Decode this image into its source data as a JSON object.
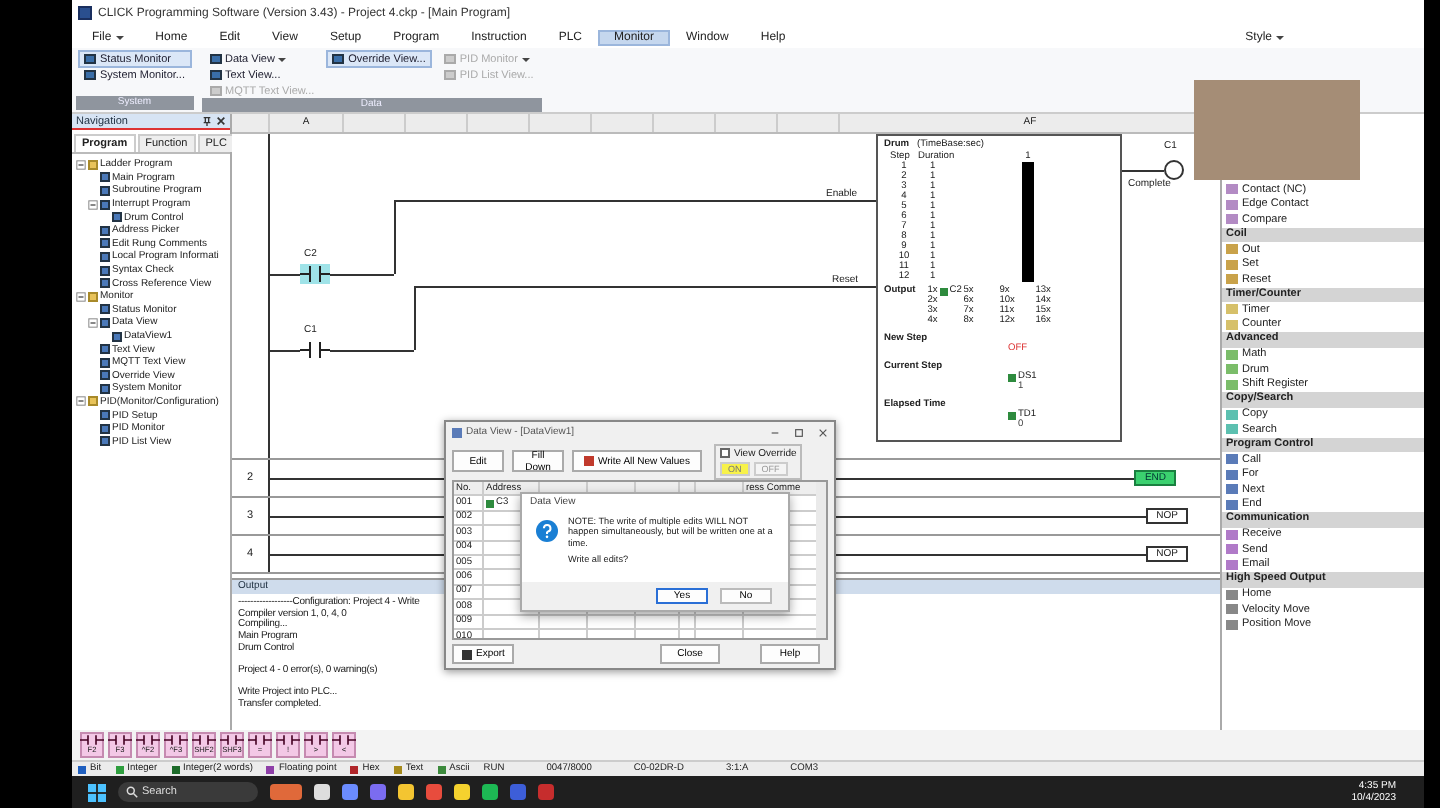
{
  "window": {
    "title": "CLICK Programming Software (Version 3.43) - Project 4.ckp - [Main Program]",
    "style_menu": "Style"
  },
  "menu": [
    {
      "label": "File",
      "selected": false,
      "dropdown": true
    },
    {
      "label": "Home",
      "selected": false,
      "dropdown": false
    },
    {
      "label": "Edit",
      "selected": false,
      "dropdown": false
    },
    {
      "label": "View",
      "selected": false,
      "dropdown": false
    },
    {
      "label": "Setup",
      "selected": false,
      "dropdown": false
    },
    {
      "label": "Program",
      "selected": false,
      "dropdown": false
    },
    {
      "label": "Instruction",
      "selected": false,
      "dropdown": false
    },
    {
      "label": "PLC",
      "selected": false,
      "dropdown": false
    },
    {
      "label": "Monitor",
      "selected": true,
      "dropdown": false
    },
    {
      "label": "Window",
      "selected": false,
      "dropdown": false
    },
    {
      "label": "Help",
      "selected": false,
      "dropdown": false
    }
  ],
  "ribbon": {
    "groups": [
      {
        "label": "System",
        "columns": [
          [
            {
              "label": "Status Monitor",
              "selected": true,
              "disabled": false,
              "dropdown": false
            },
            {
              "label": "System Monitor...",
              "selected": false,
              "disabled": false,
              "dropdown": false
            }
          ]
        ]
      },
      {
        "label": "Data",
        "columns": [
          [
            {
              "label": "Data View",
              "selected": false,
              "disabled": false,
              "dropdown": true
            },
            {
              "label": "Text View...",
              "selected": false,
              "disabled": false,
              "dropdown": false
            },
            {
              "label": "MQTT Text View...",
              "selected": false,
              "disabled": true,
              "dropdown": false
            }
          ],
          [
            {
              "label": "Override View...",
              "selected": true,
              "disabled": false,
              "dropdown": false
            }
          ],
          [
            {
              "label": "PID Monitor",
              "selected": false,
              "disabled": true,
              "dropdown": true
            },
            {
              "label": "PID List View...",
              "selected": false,
              "disabled": true,
              "dropdown": false
            }
          ]
        ]
      }
    ]
  },
  "navigation": {
    "title": "Navigation",
    "tabs": [
      {
        "label": "Program",
        "selected": true
      },
      {
        "label": "Function",
        "selected": false
      },
      {
        "label": "PLC",
        "selected": false
      }
    ],
    "tree": [
      {
        "label": "Ladder Program",
        "expanded": true,
        "children": [
          {
            "label": "Main Program"
          },
          {
            "label": "Subroutine Program"
          },
          {
            "label": "Interrupt Program",
            "expanded": true,
            "children": [
              {
                "label": "Drum Control"
              }
            ]
          },
          {
            "label": "Address Picker"
          },
          {
            "label": "Edit Rung Comments"
          },
          {
            "label": "Local Program Informati"
          },
          {
            "label": "Syntax Check"
          },
          {
            "label": "Cross Reference View"
          }
        ]
      },
      {
        "label": "Monitor",
        "expanded": true,
        "children": [
          {
            "label": "Status Monitor"
          },
          {
            "label": "Data View",
            "expanded": true,
            "children": [
              {
                "label": "DataView1"
              }
            ]
          },
          {
            "label": "Text View"
          },
          {
            "label": "MQTT Text View"
          },
          {
            "label": "Override View"
          },
          {
            "label": "System Monitor"
          }
        ]
      },
      {
        "label": "PID(Monitor/Configuration)",
        "expanded": true,
        "children": [
          {
            "label": "PID Setup"
          },
          {
            "label": "PID Monitor"
          },
          {
            "label": "PID List View"
          }
        ]
      }
    ]
  },
  "ladder": {
    "column_headers": [
      {
        "label": "A"
      },
      {
        "label": "AF"
      }
    ],
    "contacts": [
      {
        "address": "C2",
        "selected": true
      },
      {
        "address": "C1",
        "selected": false
      }
    ],
    "drum": {
      "title": "Drum",
      "timebase": "(TimeBase:sec)",
      "inputs": [
        "Enable",
        "Reset"
      ],
      "step_header": "Step",
      "duration_header": "Duration",
      "output_header": "1",
      "steps": [
        {
          "step": "1",
          "duration": "1",
          "on": true
        },
        {
          "step": "2",
          "duration": "1",
          "on": true
        },
        {
          "step": "3",
          "duration": "1",
          "on": true
        },
        {
          "step": "4",
          "duration": "1",
          "on": true
        },
        {
          "step": "5",
          "duration": "1",
          "on": true
        },
        {
          "step": "6",
          "duration": "1",
          "on": true
        },
        {
          "step": "7",
          "duration": "1",
          "on": true
        },
        {
          "step": "8",
          "duration": "1",
          "on": true
        },
        {
          "step": "9",
          "duration": "1",
          "on": true
        },
        {
          "step": "10",
          "duration": "1",
          "on": true
        },
        {
          "step": "11",
          "duration": "1",
          "on": true
        },
        {
          "step": "12",
          "duration": "1",
          "on": true
        }
      ],
      "output_label": "Output",
      "outputs": [
        {
          "label": "1x",
          "address": "C2"
        },
        {
          "label": "2x"
        },
        {
          "label": "3x"
        },
        {
          "label": "4x"
        },
        {
          "label": "5x"
        },
        {
          "label": "6x"
        },
        {
          "label": "7x"
        },
        {
          "label": "8x"
        },
        {
          "label": "9x"
        },
        {
          "label": "10x"
        },
        {
          "label": "11x"
        },
        {
          "label": "12x"
        },
        {
          "label": "13x"
        },
        {
          "label": "14x"
        },
        {
          "label": "15x"
        },
        {
          "label": "16x"
        }
      ],
      "new_step": {
        "label": "New Step",
        "value": "OFF"
      },
      "current_step": {
        "label": "Current Step",
        "address": "DS1",
        "value": "1"
      },
      "elapsed_time": {
        "label": "Elapsed Time",
        "address": "TD1",
        "value": "0"
      }
    },
    "coil": {
      "address": "C1",
      "label": "Complete"
    },
    "rungs": [
      {
        "number": "2",
        "kind": "end",
        "label": "END"
      },
      {
        "number": "3",
        "kind": "nop",
        "label": "NOP"
      },
      {
        "number": "4",
        "kind": "nop",
        "label": "NOP"
      }
    ]
  },
  "output": {
    "title": "Output",
    "paragraphs": [
      [
        "------------------Configuration: Project 4 - Write",
        "Compiler version 1, 0, 4, 0",
        "Compiling...",
        "Main Program",
        "Drum Control"
      ],
      [
        "Project 4 - 0 error(s), 0 warning(s)"
      ],
      [
        "Write Project into PLC...",
        "Transfer completed."
      ]
    ]
  },
  "instructions": {
    "sections": [
      {
        "items": [
          "Contact (NC)",
          "Edge Contact",
          "Compare"
        ]
      },
      {
        "title": "Coil",
        "items": [
          "Out",
          "Set",
          "Reset"
        ]
      },
      {
        "title": "Timer/Counter",
        "items": [
          "Timer",
          "Counter"
        ]
      },
      {
        "title": "Advanced",
        "items": [
          "Math",
          "Drum",
          "Shift Register"
        ]
      },
      {
        "title": "Copy/Search",
        "items": [
          "Copy",
          "Search"
        ]
      },
      {
        "title": "Program Control",
        "items": [
          "Call",
          "For",
          "Next",
          "End"
        ]
      },
      {
        "title": "Communication",
        "items": [
          "Receive",
          "Send",
          "Email"
        ]
      },
      {
        "title": "High Speed Output",
        "items": [
          "Home",
          "Velocity Move",
          "Position Move"
        ]
      }
    ]
  },
  "data_view_dialog": {
    "title": "Data View - [DataView1]",
    "buttons": [
      "Edit",
      "Fill Down",
      "Write All New Values"
    ],
    "override": {
      "label": "View Override",
      "checked": false,
      "on_label": "ON",
      "off_label": "OFF"
    },
    "columns": [
      "No.",
      "Address",
      "ress Comme"
    ],
    "rows": [
      {
        "no": "001",
        "address": "C3"
      },
      {
        "no": "002"
      },
      {
        "no": "003"
      },
      {
        "no": "004"
      },
      {
        "no": "005"
      },
      {
        "no": "006"
      },
      {
        "no": "007"
      },
      {
        "no": "008"
      },
      {
        "no": "009"
      },
      {
        "no": "010"
      }
    ],
    "footer_buttons": [
      "Export",
      "Close",
      "Help"
    ]
  },
  "message_box": {
    "title": "Data View",
    "message": "NOTE: The write of multiple edits WILL NOT happen simultaneously, but will be written one at a time.",
    "question": "Write all edits?",
    "buttons": [
      {
        "label": "Yes",
        "selected": true
      },
      {
        "label": "No",
        "selected": false
      }
    ]
  },
  "function_keys": [
    "F2",
    "F3",
    "^F2",
    "^F3",
    "SHF2",
    "SHF3",
    "=",
    "!",
    ">",
    "<"
  ],
  "status_bar": {
    "data_types": [
      {
        "label": "Bit",
        "color": "#1f5fbf"
      },
      {
        "label": "Integer",
        "color": "#2e9e3e"
      },
      {
        "label": "Integer(2 words)",
        "color": "#1d6b2a"
      },
      {
        "label": "Floating point",
        "color": "#8e3fa8"
      },
      {
        "label": "Hex",
        "color": "#b0262a"
      },
      {
        "label": "Text",
        "color": "#a68a1c"
      },
      {
        "label": "Ascii",
        "color": "#3c8a3c"
      }
    ],
    "fields": [
      "RUN",
      "0047/8000",
      "C0-02DR-D",
      "3:1:A",
      "COM3"
    ]
  },
  "taskbar": {
    "search_placeholder": "Search",
    "time": "4:35 PM",
    "date": "10/4/2023"
  }
}
